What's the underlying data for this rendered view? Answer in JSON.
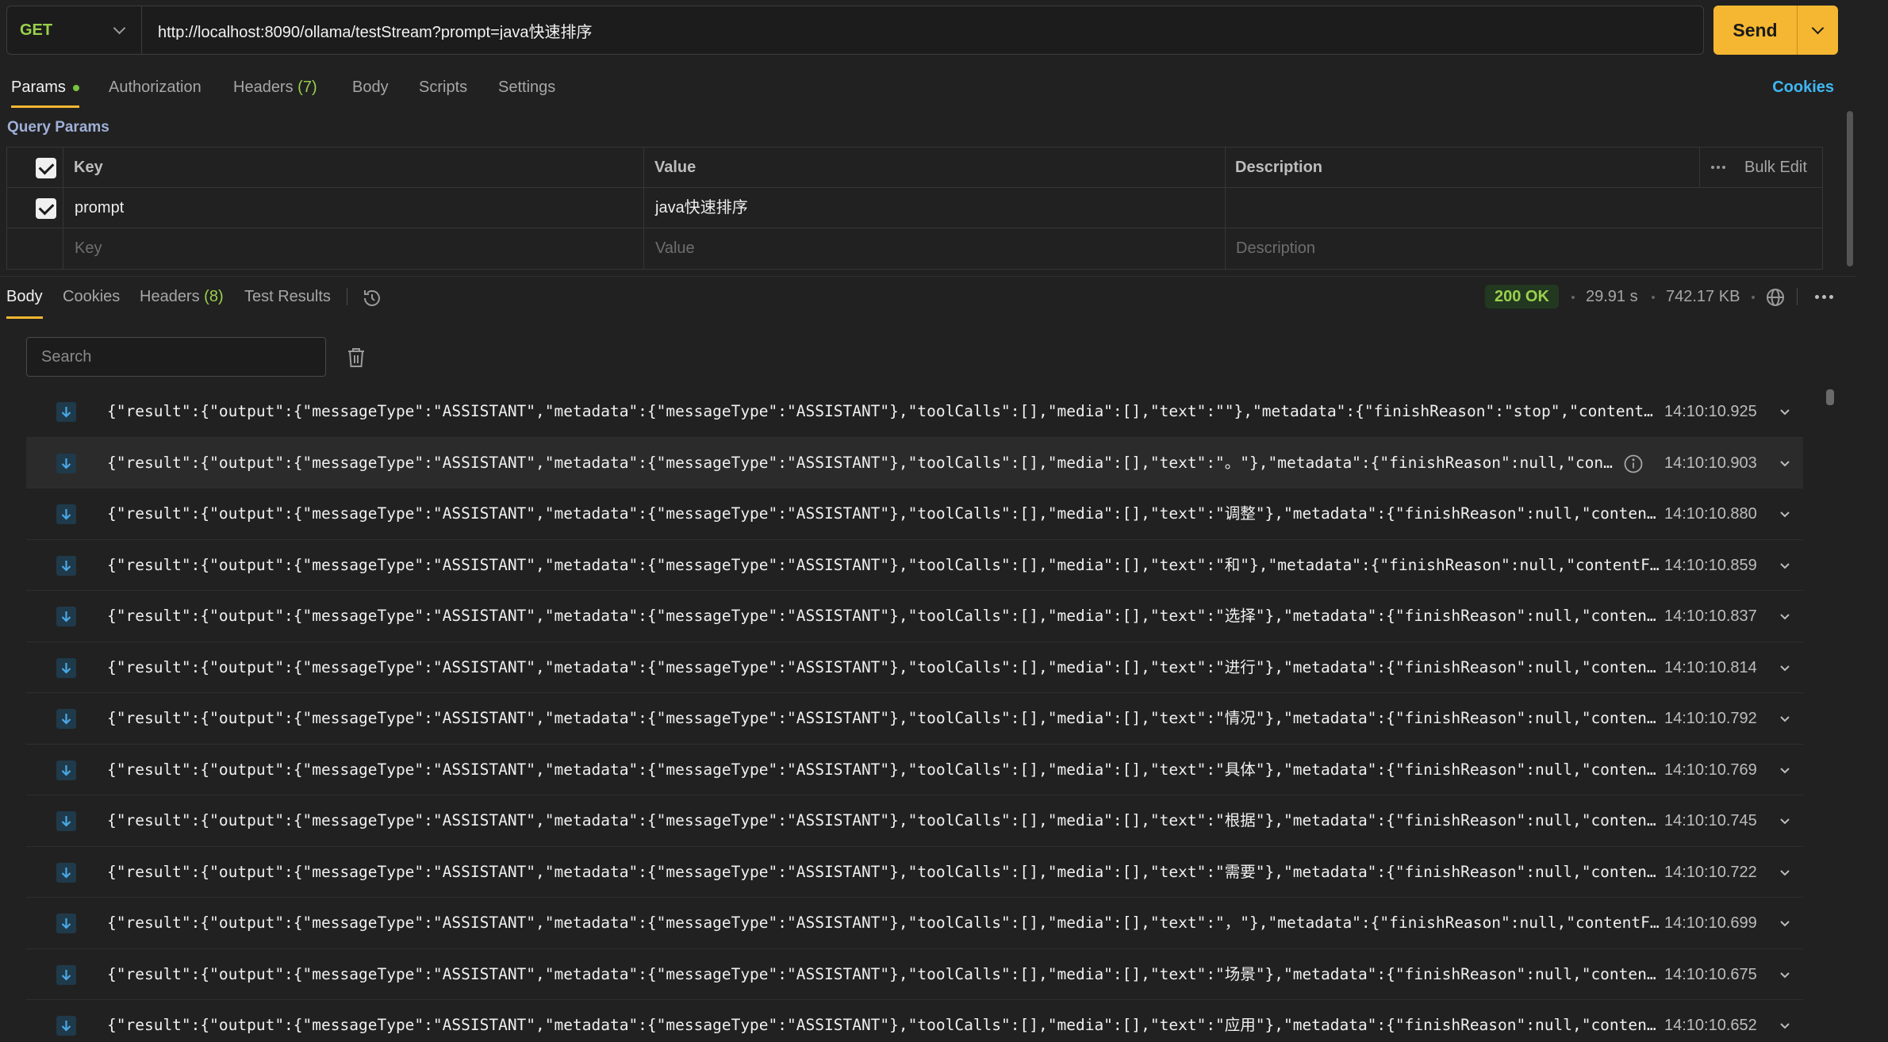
{
  "request": {
    "method": "GET",
    "url": "http://localhost:8090/ollama/testStream?prompt=java快速排序",
    "send_label": "Send"
  },
  "request_tabs": {
    "params": "Params",
    "authorization": "Authorization",
    "headers": "Headers",
    "headers_count": "(7)",
    "body": "Body",
    "scripts": "Scripts",
    "settings": "Settings",
    "cookies": "Cookies"
  },
  "query_params": {
    "title": "Query Params",
    "columns": {
      "key": "Key",
      "value": "Value",
      "description": "Description",
      "bulk_edit": "Bulk Edit"
    },
    "rows": [
      {
        "key": "prompt",
        "value": "java快速排序",
        "description": ""
      }
    ],
    "placeholders": {
      "key": "Key",
      "value": "Value",
      "description": "Description"
    }
  },
  "response": {
    "tabs": {
      "body": "Body",
      "cookies": "Cookies",
      "headers": "Headers",
      "headers_count": "(8)",
      "test_results": "Test Results"
    },
    "status": "200 OK",
    "time": "29.91 s",
    "size": "742.17 KB",
    "search_placeholder": "Search",
    "events": [
      {
        "text": "{\"result\":{\"output\":{\"messageType\":\"ASSISTANT\",\"metadata\":{\"messageType\":\"ASSISTANT\"},\"toolCalls\":[],\"media\":[],\"text\":\"\"},\"metadata\":{\"finishReason\":\"stop\",\"contentFil...",
        "time": "14:10:10.925"
      },
      {
        "text": "{\"result\":{\"output\":{\"messageType\":\"ASSISTANT\",\"metadata\":{\"messageType\":\"ASSISTANT\"},\"toolCalls\":[],\"media\":[],\"text\":\"。\"},\"metadata\":{\"finishReason\":null,\"conte...",
        "time": "14:10:10.903"
      },
      {
        "text": "{\"result\":{\"output\":{\"messageType\":\"ASSISTANT\",\"metadata\":{\"messageType\":\"ASSISTANT\"},\"toolCalls\":[],\"media\":[],\"text\":\"调整\"},\"metadata\":{\"finishReason\":null,\"contentFi...",
        "time": "14:10:10.880"
      },
      {
        "text": "{\"result\":{\"output\":{\"messageType\":\"ASSISTANT\",\"metadata\":{\"messageType\":\"ASSISTANT\"},\"toolCalls\":[],\"media\":[],\"text\":\"和\"},\"metadata\":{\"finishReason\":null,\"contentFil...",
        "time": "14:10:10.859"
      },
      {
        "text": "{\"result\":{\"output\":{\"messageType\":\"ASSISTANT\",\"metadata\":{\"messageType\":\"ASSISTANT\"},\"toolCalls\":[],\"media\":[],\"text\":\"选择\"},\"metadata\":{\"finishReason\":null,\"contentFi...",
        "time": "14:10:10.837"
      },
      {
        "text": "{\"result\":{\"output\":{\"messageType\":\"ASSISTANT\",\"metadata\":{\"messageType\":\"ASSISTANT\"},\"toolCalls\":[],\"media\":[],\"text\":\"进行\"},\"metadata\":{\"finishReason\":null,\"contentFi...",
        "time": "14:10:10.814"
      },
      {
        "text": "{\"result\":{\"output\":{\"messageType\":\"ASSISTANT\",\"metadata\":{\"messageType\":\"ASSISTANT\"},\"toolCalls\":[],\"media\":[],\"text\":\"情况\"},\"metadata\":{\"finishReason\":null,\"contentFi...",
        "time": "14:10:10.792"
      },
      {
        "text": "{\"result\":{\"output\":{\"messageType\":\"ASSISTANT\",\"metadata\":{\"messageType\":\"ASSISTANT\"},\"toolCalls\":[],\"media\":[],\"text\":\"具体\"},\"metadata\":{\"finishReason\":null,\"contentFi...",
        "time": "14:10:10.769"
      },
      {
        "text": "{\"result\":{\"output\":{\"messageType\":\"ASSISTANT\",\"metadata\":{\"messageType\":\"ASSISTANT\"},\"toolCalls\":[],\"media\":[],\"text\":\"根据\"},\"metadata\":{\"finishReason\":null,\"contentFi...",
        "time": "14:10:10.745"
      },
      {
        "text": "{\"result\":{\"output\":{\"messageType\":\"ASSISTANT\",\"metadata\":{\"messageType\":\"ASSISTANT\"},\"toolCalls\":[],\"media\":[],\"text\":\"需要\"},\"metadata\":{\"finishReason\":null,\"contentFi...",
        "time": "14:10:10.722"
      },
      {
        "text": "{\"result\":{\"output\":{\"messageType\":\"ASSISTANT\",\"metadata\":{\"messageType\":\"ASSISTANT\"},\"toolCalls\":[],\"media\":[],\"text\":\"，\"},\"metadata\":{\"finishReason\":null,\"contentFil...",
        "time": "14:10:10.699"
      },
      {
        "text": "{\"result\":{\"output\":{\"messageType\":\"ASSISTANT\",\"metadata\":{\"messageType\":\"ASSISTANT\"},\"toolCalls\":[],\"media\":[],\"text\":\"场景\"},\"metadata\":{\"finishReason\":null,\"contentFi...",
        "time": "14:10:10.675"
      },
      {
        "text": "{\"result\":{\"output\":{\"messageType\":\"ASSISTANT\",\"metadata\":{\"messageType\":\"ASSISTANT\"},\"toolCalls\":[],\"media\":[],\"text\":\"应用\"},\"metadata\":{\"finishReason\":null,\"contentFi...",
        "time": "14:10:10.652"
      }
    ]
  },
  "colors": {
    "method_get": "#9ad04d",
    "send_button": "#f5b731",
    "cookies_link": "#3fb8f3",
    "status_ok": "#9ad04d",
    "params_dot": "#78c43f"
  },
  "icons": [
    "chevron-down-icon",
    "checkbox-icon",
    "more-horizontal-icon",
    "history-icon",
    "globe-icon",
    "trash-icon",
    "arrow-down-icon",
    "info-icon"
  ]
}
